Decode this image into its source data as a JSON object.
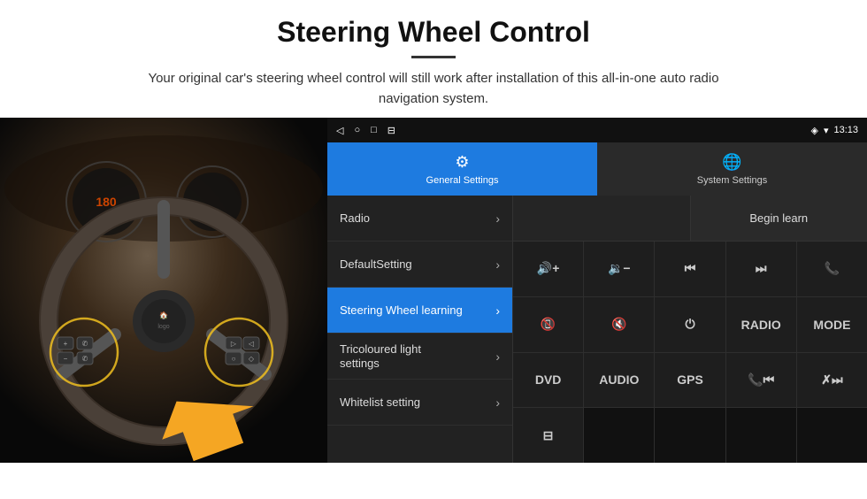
{
  "header": {
    "title": "Steering Wheel Control",
    "divider": true,
    "subtitle": "Your original car's steering wheel control will still work after installation of this all-in-one auto radio navigation system."
  },
  "status_bar": {
    "nav_icons": [
      "◁",
      "○",
      "□",
      "⊟"
    ],
    "right_icons": [
      "◈",
      "▾",
      "13:13"
    ]
  },
  "tabs": [
    {
      "id": "general",
      "label": "General Settings",
      "active": true
    },
    {
      "id": "system",
      "label": "System Settings",
      "active": false
    }
  ],
  "menu": {
    "items": [
      {
        "id": "radio",
        "label": "Radio",
        "active": false
      },
      {
        "id": "default-setting",
        "label": "DefaultSetting",
        "active": false
      },
      {
        "id": "steering-wheel",
        "label": "Steering Wheel learning",
        "active": true
      },
      {
        "id": "tricoloured-light",
        "label1": "Tricoloured light",
        "label2": "settings",
        "multiline": true,
        "active": false
      },
      {
        "id": "whitelist",
        "label": "Whitelist setting",
        "active": false
      }
    ]
  },
  "controls": {
    "begin_learn_label": "Begin learn",
    "rows": [
      [
        {
          "id": "vol-up",
          "symbol": "🔊+",
          "label": "Vol+"
        },
        {
          "id": "vol-dn",
          "symbol": "🔉−",
          "label": "Vol-"
        },
        {
          "id": "prev-track",
          "symbol": "⏮",
          "label": "Prev"
        },
        {
          "id": "next-track",
          "symbol": "⏭",
          "label": "Next"
        },
        {
          "id": "call",
          "symbol": "✆",
          "label": "Call"
        }
      ],
      [
        {
          "id": "hang-up",
          "symbol": "✆",
          "label": "Hang",
          "style": "hang"
        },
        {
          "id": "mute",
          "symbol": "🔇",
          "label": "Mute"
        },
        {
          "id": "power",
          "symbol": "⏻",
          "label": "Power"
        },
        {
          "id": "radio-btn",
          "symbol": "RADIO",
          "label": "Radio",
          "text": true
        },
        {
          "id": "mode",
          "symbol": "MODE",
          "label": "Mode",
          "text": true
        }
      ],
      [
        {
          "id": "dvd",
          "symbol": "DVD",
          "label": "DVD",
          "text": true
        },
        {
          "id": "audio",
          "symbol": "AUDIO",
          "label": "Audio",
          "text": true
        },
        {
          "id": "gps",
          "symbol": "GPS",
          "label": "GPS",
          "text": true
        },
        {
          "id": "call2",
          "symbol": "✆⏮",
          "label": "Call2"
        },
        {
          "id": "next2",
          "symbol": "✗⏭",
          "label": "Next2"
        }
      ],
      [
        {
          "id": "usb",
          "symbol": "⊟",
          "label": "USB"
        }
      ]
    ]
  }
}
